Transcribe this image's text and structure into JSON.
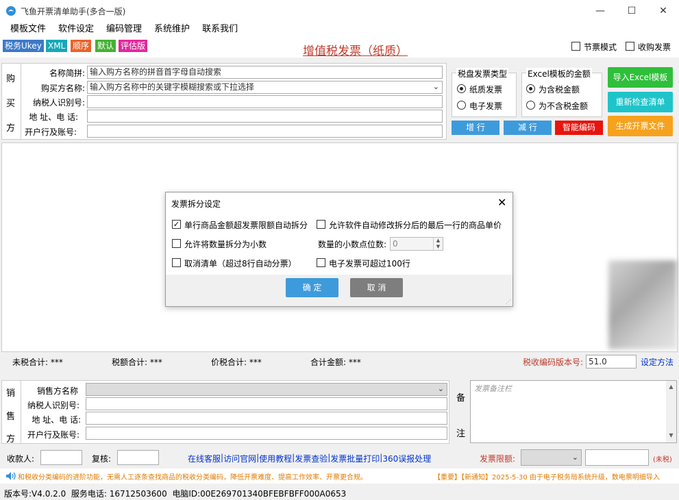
{
  "window": {
    "title": "飞鱼开票清单助手(多合一版)"
  },
  "menu": [
    "模板文件",
    "软件设定",
    "编码管理",
    "系统维护",
    "联系我们"
  ],
  "tags": [
    {
      "label": "税务Ukey",
      "color": "#3d79c9"
    },
    {
      "label": "XML",
      "color": "#18a8b8"
    },
    {
      "label": "顺序",
      "color": "#e8632b"
    },
    {
      "label": "默认",
      "color": "#45b035"
    },
    {
      "label": "评估版",
      "color": "#e0299e"
    }
  ],
  "invoice_title": "增值税发票（纸质）",
  "top_options": {
    "jiepiao": "节票模式",
    "shougou": "收购发票"
  },
  "buyer": {
    "side_chars": [
      "购",
      "买",
      "方"
    ],
    "name_abbr_label": "名称简拼:",
    "name_abbr_placeholder": "输入购方名称的拼音首字母自动搜索",
    "name_label": "购买方名称:",
    "name_placeholder": "输入购方名称中的关键字模糊搜索或下拉选择",
    "taxid_label": "纳税人识别号:",
    "address_label": "地 址、电 话:",
    "bank_label": "开户行及账号:"
  },
  "invoice_type_group": {
    "title": "税盘发票类型",
    "options": [
      "纸质发票",
      "电子发票"
    ],
    "selected": 0
  },
  "excel_amount_group": {
    "title": "Excel模板的金额",
    "options": [
      "为含税金额",
      "为不含税金额"
    ],
    "selected": 0
  },
  "row_buttons": {
    "add": "增 行",
    "remove": "减 行",
    "smart": "智能编码"
  },
  "side_buttons": {
    "import": "导入Excel模板",
    "recheck": "重新检查清单",
    "generate": "生成开票文件"
  },
  "dialog": {
    "title": "发票拆分设定",
    "options": {
      "auto_split": {
        "label": "单行商品金额超发票限额自动拆分",
        "checked": true
      },
      "allow_modify_price": {
        "label": "允许软件自动修改拆分后的最后一行的商品单价",
        "checked": false
      },
      "allow_decimal": {
        "label": "允许将数量拆分为小数",
        "checked": false
      },
      "cancel_list": {
        "label": "取消清单（超过8行自动分票）",
        "checked": false
      },
      "e_invoice_100": {
        "label": "电子发票可超过100行",
        "checked": false
      }
    },
    "decimal_label": "数量的小数点位数:",
    "decimal_value": "0",
    "ok": "确 定",
    "cancel": "取 消"
  },
  "totals": {
    "untaxed": "未税合计: ***",
    "tax": "税额合计: ***",
    "total_with_tax": "价税合计: ***",
    "sum": "合计金额: ***",
    "code_version_label": "税收编码版本号:",
    "code_version_value": "51.0",
    "set_method": "设定方法"
  },
  "seller": {
    "side_chars": [
      "销",
      "售",
      "方"
    ],
    "name_label": "销售方名称",
    "taxid_label": "纳税人识别号:",
    "address_label": "地 址、电 话:",
    "bank_label": "开户行及账号:"
  },
  "note": {
    "side_chars": [
      "备",
      "注"
    ],
    "placeholder": "发票备注栏"
  },
  "bottom": {
    "payee_label": "收款人:",
    "reviewer_label": "复核:",
    "links": [
      "在线客服",
      "访问官网",
      "使用教程",
      "发票查验",
      "发票批量打印",
      "360误报处理"
    ],
    "limit_label": "发票限额:",
    "untaxed_hint": "(未税)"
  },
  "notice": {
    "left": "和税收分类编码的进阶功能，无需人工逐条查找商品的税收分类编码，降低开票难度、提高工作效率、开票更合规。",
    "right": "【重要】【新通知】2025-5-30 由于电子税务局系统升级，数电票明细导入"
  },
  "status": {
    "text": "版本号:V4.0.2.0  服务电话: 16712503600  电脑ID:00E269701340BFEBFBFF000A0653"
  },
  "colors": {
    "accent_red": "#c0392b",
    "link_blue": "#0033cc",
    "btn_green": "#2fbf3b",
    "btn_teal": "#1fc4c9",
    "btn_orange": "#f6a21e",
    "btn_red": "#e8140e"
  }
}
